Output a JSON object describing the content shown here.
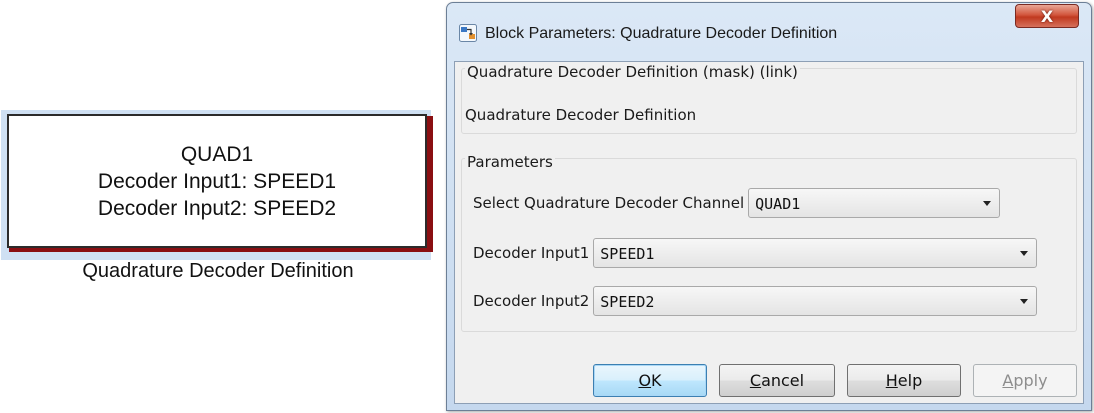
{
  "block": {
    "line1": "QUAD1",
    "line2": "Decoder Input1: SPEED1",
    "line3": "Decoder Input2: SPEED2",
    "caption": "Quadrature Decoder Definition",
    "shadow_color": "#8a0f12"
  },
  "dialog": {
    "title": "Block Parameters: Quadrature Decoder Definition",
    "close_label": "X",
    "close_color": "#c0391f",
    "mask_title": "Quadrature Decoder Definition (mask) (link)",
    "mask_description": "Quadrature Decoder Definition",
    "parameters_title": "Parameters",
    "params": [
      {
        "label": "Select Quadrature Decoder Channel",
        "value": "QUAD1"
      },
      {
        "label": "Decoder Input1",
        "value": "SPEED1"
      },
      {
        "label": "Decoder Input2",
        "value": "SPEED2"
      }
    ],
    "buttons": {
      "ok": {
        "mnemonic": "O",
        "rest": "K"
      },
      "cancel": {
        "mnemonic": "C",
        "rest": "ancel"
      },
      "help": {
        "mnemonic": "H",
        "rest": "elp"
      },
      "apply": {
        "mnemonic": "A",
        "rest": "pply",
        "enabled": false
      }
    }
  }
}
